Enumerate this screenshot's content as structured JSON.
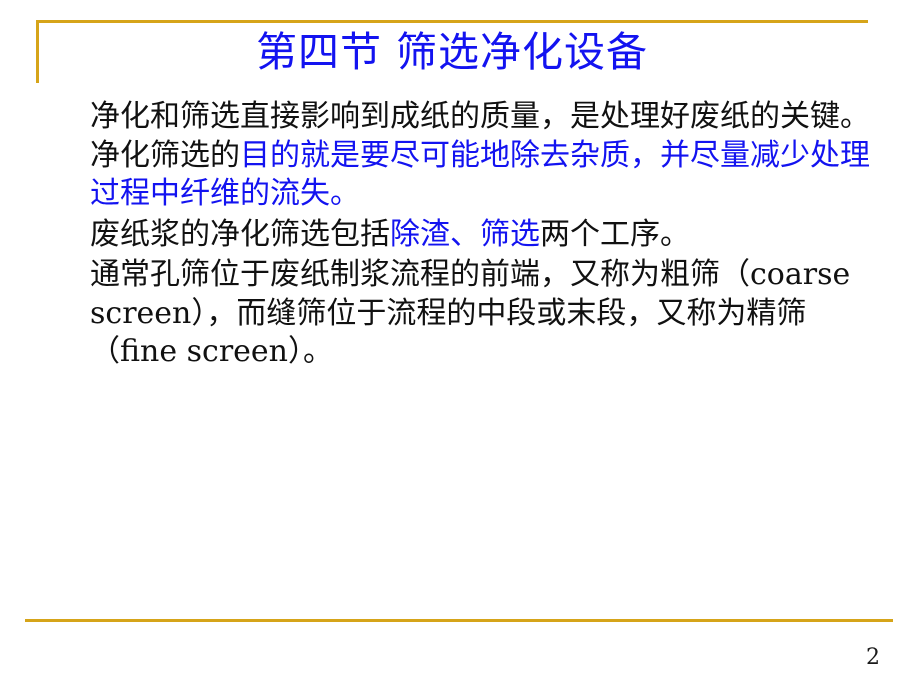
{
  "slide": {
    "page_number": "2",
    "accent_color": "#D6A419",
    "title_color": "#1313F0",
    "body_color": "#111111",
    "highlight_color": "#1313F0",
    "background_color": "#FFFFFF"
  },
  "title": {
    "text": "第四节 筛选净化设备"
  },
  "body": {
    "paragraph1": {
      "run1_black": "净化和筛选直接影响到成纸的质量，是处理好废纸的关键。净化筛选的",
      "run2_blue": "目的就是要尽可能地除去杂质，并尽量减少处理过程中纤维的流失。"
    },
    "paragraph2": {
      "run1_black": "废纸浆的净化筛选包括",
      "run2_blue": "除渣、筛选",
      "run3_black": "两个工序。"
    },
    "paragraph3": {
      "run1_black": "通常孔筛位于废纸制浆流程的前端，又称为粗筛（coarse screen），而缝筛位于流程的中段或末段，又称为精筛（fine screen）。"
    }
  }
}
